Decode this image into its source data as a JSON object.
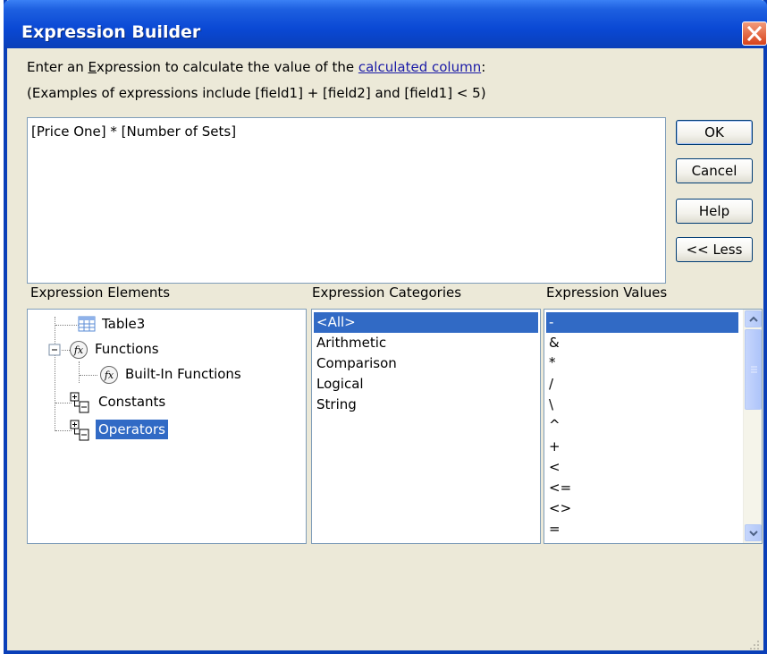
{
  "window": {
    "title": "Expression Builder",
    "close_icon": "close-icon"
  },
  "instructions": {
    "line1_pre": "Enter an ",
    "line1_u": "E",
    "line1_mid": "xpression to calculate the value of the ",
    "line1_link": "calculated column",
    "line1_post": ":",
    "line2": "(Examples of expressions include [field1] + [field2] and [field1] < 5)"
  },
  "expression": {
    "value": "[Price One] * [Number of Sets]"
  },
  "buttons": {
    "ok": "OK",
    "cancel": "Cancel",
    "help": "Help",
    "less": "<< Less"
  },
  "elements": {
    "label": "Expression Elements",
    "items": [
      {
        "label": "Table3",
        "icon": "table-icon"
      },
      {
        "label": "Functions",
        "icon": "function-icon"
      },
      {
        "label": "Built-In Functions",
        "icon": "function-icon"
      },
      {
        "label": "Constants",
        "icon": "tree-node-icon"
      },
      {
        "label": "Operators",
        "icon": "tree-node-icon",
        "selected": true
      }
    ]
  },
  "categories": {
    "label": "Expression Categories",
    "items": [
      "<All>",
      "Arithmetic",
      "Comparison",
      "Logical",
      "String"
    ],
    "selected": "<All>"
  },
  "values": {
    "label": "Expression Values",
    "items": [
      "-",
      "&",
      "*",
      "/",
      "\\",
      "^",
      "+",
      "<",
      "<=",
      "<>",
      "="
    ],
    "selected": "-"
  },
  "colors": {
    "titlebar": "#0a48d4",
    "selection": "#316ac5",
    "dialog_bg": "#ece9d8",
    "link": "#1a1aa6"
  }
}
